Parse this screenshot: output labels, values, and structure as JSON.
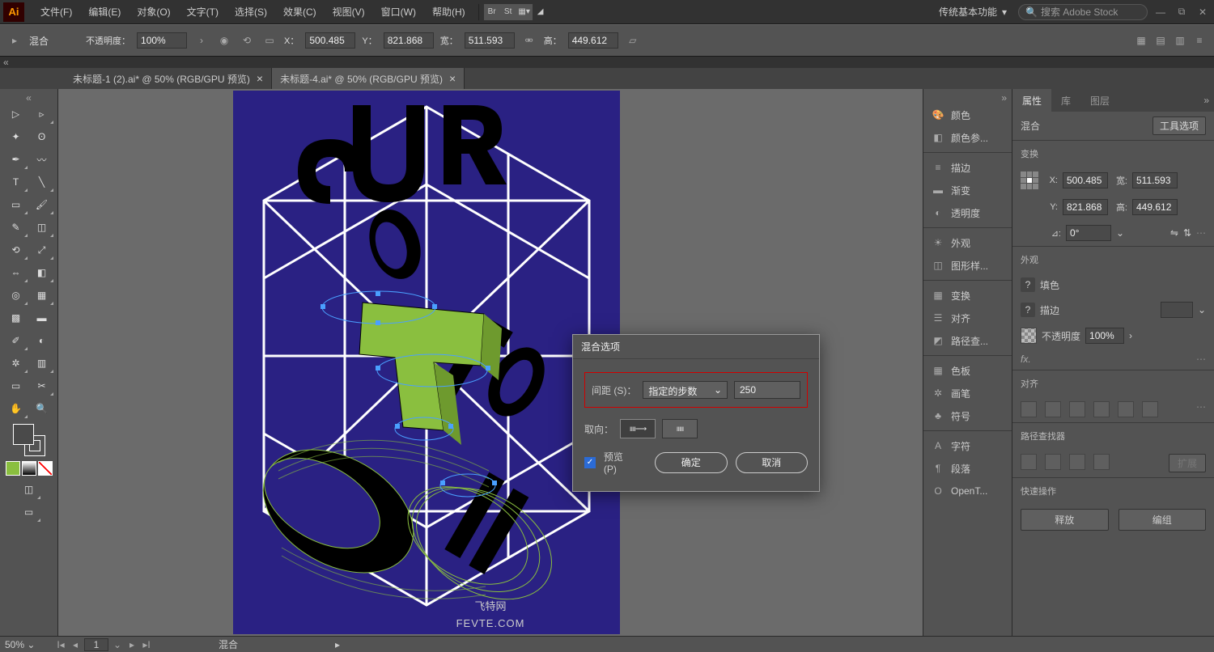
{
  "menu": {
    "file": "文件(F)",
    "edit": "编辑(E)",
    "object": "对象(O)",
    "type": "文字(T)",
    "select": "选择(S)",
    "effect": "效果(C)",
    "view": "视图(V)",
    "window": "窗口(W)",
    "help": "帮助(H)",
    "br": "Br",
    "st": "St",
    "workspace": "传统基本功能",
    "search_placeholder": "搜索 Adobe Stock"
  },
  "optbar": {
    "type": "混合",
    "opacity_label": "不透明度：",
    "opacity": "100%",
    "x_label": "X：",
    "x": "500.485",
    "y_label": "Y：",
    "y": "821.868",
    "w_label": "宽：",
    "w": "511.593",
    "h_label": "高：",
    "h": "449.612"
  },
  "tabs": {
    "t1": "未标题-1 (2).ai* @ 50% (RGB/GPU 预览)",
    "t2": "未标题-4.ai* @ 50% (RGB/GPU 预览)"
  },
  "docks": {
    "colors": "颜色",
    "color_guide": "颜色参...",
    "stroke": "描边",
    "gradient": "渐变",
    "transp": "透明度",
    "appearance": "外观",
    "graphic_st": "图形样...",
    "transform": "变换",
    "align": "对齐",
    "pathfinder": "路径查...",
    "swatches": "色板",
    "brushes": "画笔",
    "symbols": "符号",
    "character": "字符",
    "paragraph": "段落",
    "opentype": "OpenT...",
    "layers_tab": "图层"
  },
  "rpanel": {
    "tab_prop": "属性",
    "tab_lib": "库",
    "sel_type": "混合",
    "tool_opts": "工具选项",
    "transform": "变换",
    "x": "500.485",
    "y": "821.868",
    "w": "511.593",
    "h": "449.612",
    "angle": "0°",
    "appearance": "外观",
    "fill": "填色",
    "stroke": "描边",
    "opacity_label": "不透明度",
    "opacity": "100%",
    "align": "对齐",
    "pathfinder": "路径查找器",
    "expand": "扩展",
    "quick": "快速操作",
    "release": "释放",
    "group": "编组"
  },
  "dialog": {
    "title": "混合选项",
    "spacing_label": "间距 (S)：",
    "spacing_mode": "指定的步数",
    "spacing_val": "250",
    "orient_label": "取向：",
    "preview": "预览 (P)",
    "ok": "确定",
    "cancel": "取消"
  },
  "status": {
    "zoom": "50%",
    "page": "1",
    "type": "混合"
  },
  "watermark": {
    "top": "飞特网",
    "bottom": "FEVTE.COM"
  }
}
